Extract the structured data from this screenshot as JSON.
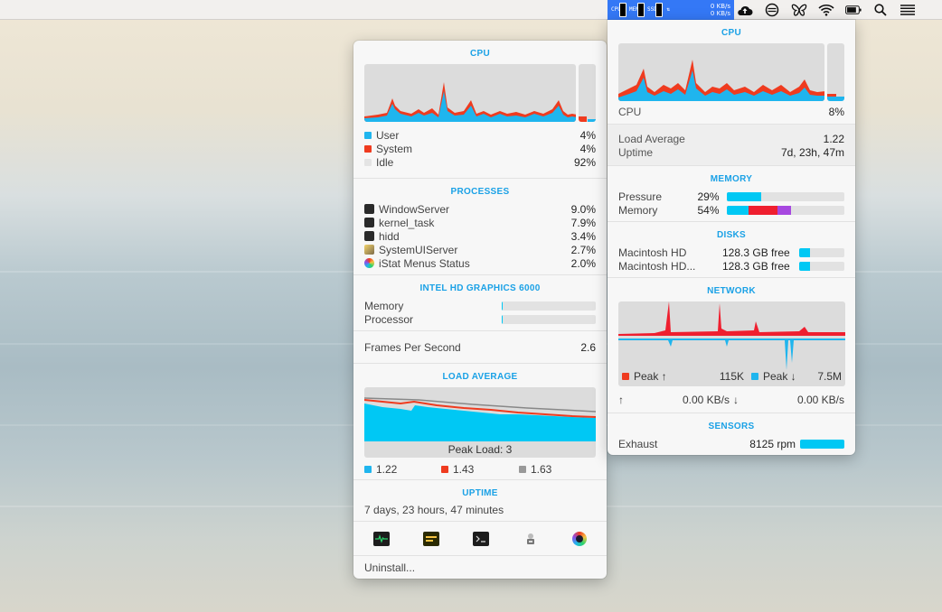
{
  "menubar": {
    "istat_labels": [
      "CPU",
      "MEM",
      "SSD"
    ],
    "net_up": "0 KB/s",
    "net_down": "0 KB/s",
    "icons": [
      "cloud-upload-icon",
      "circle-slash-icon",
      "butterfly-icon",
      "wifi-icon",
      "battery-icon",
      "search-icon",
      "list-icon"
    ]
  },
  "left": {
    "cpu": {
      "title": "CPU",
      "items": [
        {
          "label": "User",
          "value": "4%",
          "color": "#1fb5ee"
        },
        {
          "label": "System",
          "value": "4%",
          "color": "#ef3b1f"
        },
        {
          "label": "Idle",
          "value": "92%",
          "color": "#e4e4e4"
        }
      ]
    },
    "processes": {
      "title": "PROCESSES",
      "items": [
        {
          "name": "WindowServer",
          "value": "9.0%"
        },
        {
          "name": "kernel_task",
          "value": "7.9%"
        },
        {
          "name": "hidd",
          "value": "3.4%"
        },
        {
          "name": "SystemUIServer",
          "value": "2.7%"
        },
        {
          "name": "iStat Menus Status",
          "value": "2.0%"
        }
      ]
    },
    "gpu": {
      "title": "INTEL HD GRAPHICS 6000",
      "memory_label": "Memory",
      "processor_label": "Processor",
      "memory_fraction": 0.01,
      "processor_fraction": 0.01
    },
    "fps": {
      "label": "Frames Per Second",
      "value": "2.6"
    },
    "load": {
      "title": "LOAD AVERAGE",
      "peak_label": "Peak Load: 3",
      "legend": [
        {
          "value": "1.22",
          "color": "#1fb5ee"
        },
        {
          "value": "1.43",
          "color": "#ef3b1f"
        },
        {
          "value": "1.63",
          "color": "#999999"
        }
      ]
    },
    "uptime": {
      "title": "UPTIME",
      "text": "7 days, 23 hours, 47 minutes"
    },
    "dock_icons": [
      "activity-monitor-icon",
      "console-icon",
      "terminal-icon",
      "system-info-icon",
      "istat-menus-icon"
    ],
    "uninstall": "Uninstall..."
  },
  "right": {
    "cpu": {
      "title": "CPU",
      "label": "CPU",
      "value": "8%"
    },
    "load": {
      "label": "Load Average",
      "value": "1.22",
      "uptime_label": "Uptime",
      "uptime_value": "7d, 23h, 47m"
    },
    "memory": {
      "title": "MEMORY",
      "pressure_label": "Pressure",
      "pressure_value": "29%",
      "pressure_fraction": 0.29,
      "memory_label": "Memory",
      "memory_value": "54%"
    },
    "disks": {
      "title": "DISKS",
      "items": [
        {
          "name": "Macintosh HD",
          "free": "128.3 GB free",
          "fraction": 0.23
        },
        {
          "name": "Macintosh HD...",
          "free": "128.3 GB free",
          "fraction": 0.23
        }
      ]
    },
    "network": {
      "title": "NETWORK",
      "peak_up_label": "Peak ↑",
      "peak_up_value": "115K",
      "peak_down_label": "Peak ↓",
      "peak_down_value": "7.5M",
      "up_arrow": "↑",
      "up_value": "0.00 KB/s",
      "down_arrow": "↓",
      "down_value": "0.00 KB/s"
    },
    "sensors": {
      "title": "SENSORS",
      "label": "Exhaust",
      "value": "8125 rpm",
      "fraction": 1.0
    }
  }
}
